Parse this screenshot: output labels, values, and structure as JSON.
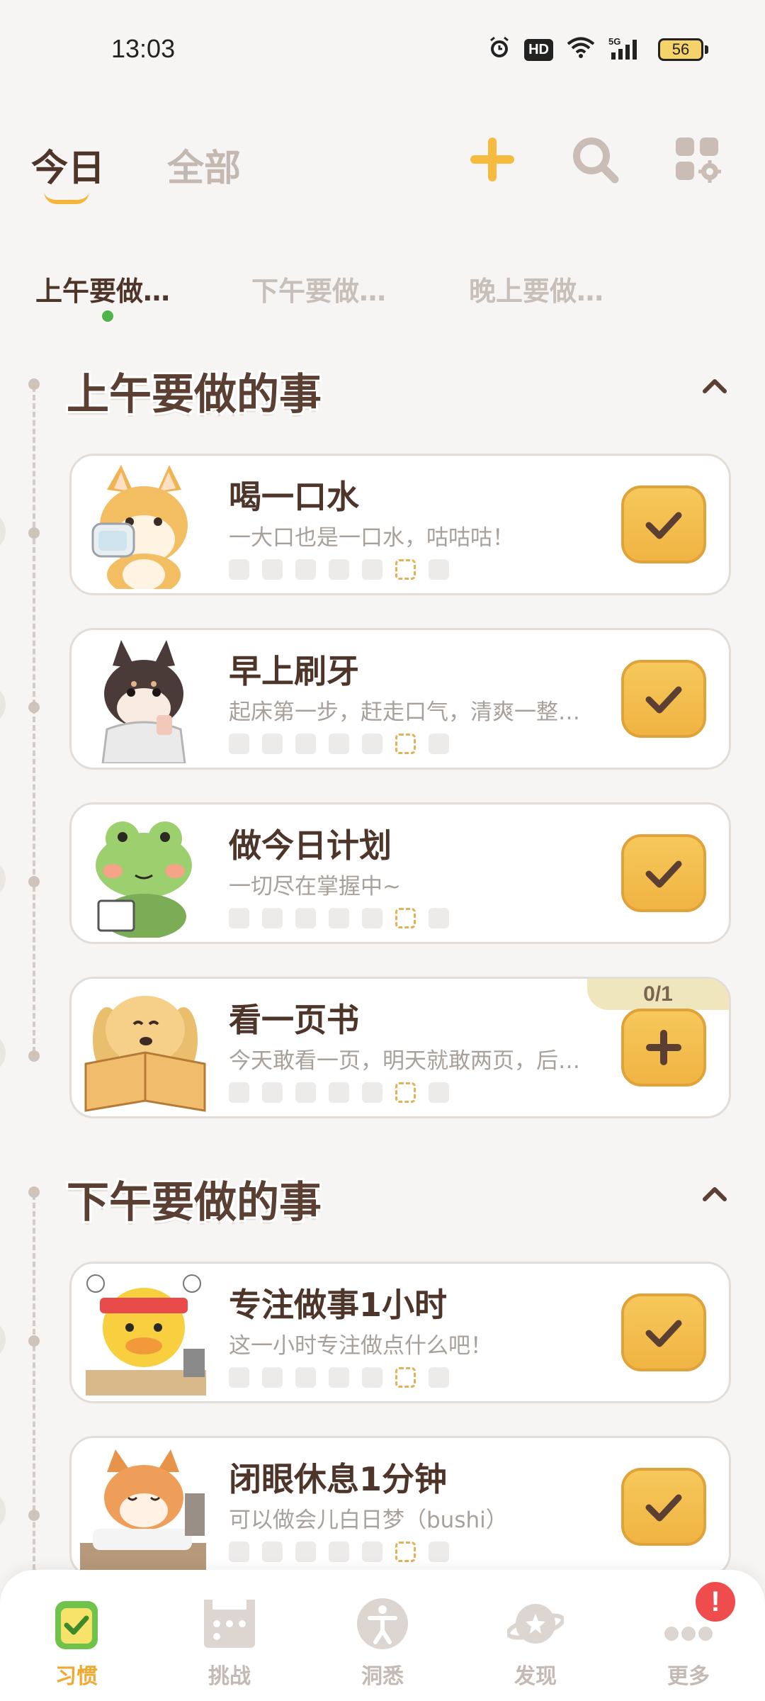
{
  "status_bar": {
    "time": "13:03",
    "network": "5G",
    "hd": "HD",
    "battery": "56"
  },
  "header": {
    "tabs": [
      {
        "label": "今日",
        "active": true
      },
      {
        "label": "全部",
        "active": false
      }
    ],
    "icons": [
      "plus-icon",
      "search-icon",
      "grid-settings-icon"
    ]
  },
  "sub_tabs": [
    {
      "label": "上午要做…",
      "active": true
    },
    {
      "label": "下午要做…",
      "active": false
    },
    {
      "label": "晚上要做…",
      "active": false
    }
  ],
  "sections": [
    {
      "title": "上午要做的事",
      "habits": [
        {
          "title": "喝一口水",
          "desc": "一大口也是一口水，咕咕咕！",
          "action": "check",
          "illustration": "shiba-drinking"
        },
        {
          "title": "早上刷牙",
          "desc": "起床第一步，赶走口气，清爽一整…",
          "action": "check",
          "illustration": "black-shiba-brushing"
        },
        {
          "title": "做今日计划",
          "desc": "一切尽在掌握中~",
          "action": "check",
          "illustration": "frog-planning"
        },
        {
          "title": "看一页书",
          "desc": "今天敢看一页，明天就敢两页，后…",
          "action": "add",
          "progress": "0/1",
          "illustration": "dog-reading"
        }
      ]
    },
    {
      "title": "下午要做的事",
      "habits": [
        {
          "title": "专注做事1小时",
          "desc": "这一小时专注做点什么吧！",
          "action": "check",
          "illustration": "duck-studying"
        },
        {
          "title": "闭眼休息1分钟",
          "desc": "可以做会儿白日梦（bushi）",
          "action": "check",
          "illustration": "corgi-resting"
        }
      ]
    }
  ],
  "bottom_nav": [
    {
      "label": "习惯",
      "active": true,
      "icon": "habit-icon"
    },
    {
      "label": "挑战",
      "active": false,
      "icon": "challenge-icon"
    },
    {
      "label": "洞悉",
      "active": false,
      "icon": "insight-icon"
    },
    {
      "label": "发现",
      "active": false,
      "icon": "discover-icon"
    },
    {
      "label": "更多",
      "active": false,
      "icon": "more-icon"
    }
  ],
  "notification_badge": "!",
  "colors": {
    "accent": "#f3b63b",
    "text_dark": "#4e352a",
    "text_muted": "#c3b9b1",
    "check_bg": "#f2bd4b",
    "active_dot": "#4fb54a",
    "badge": "#ef4d4d"
  }
}
